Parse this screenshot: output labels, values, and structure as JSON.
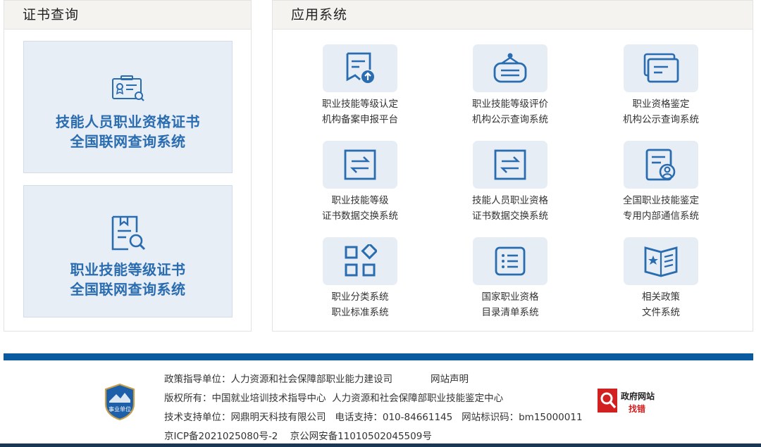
{
  "cert_panel": {
    "title": "证书查询",
    "cards": [
      {
        "line1": "技能人员职业资格证书",
        "line2": "全国联网查询系统"
      },
      {
        "line1": "职业技能等级证书",
        "line2": "全国联网查询系统"
      }
    ]
  },
  "apps_panel": {
    "title": "应用系统",
    "apps": [
      {
        "line1": "职业技能等级认定",
        "line2": "机构备案申报平台",
        "icon": "document-upload-icon"
      },
      {
        "line1": "职业技能等级评价",
        "line2": "机构公示查询系统",
        "icon": "notice-board-icon"
      },
      {
        "line1": "职业资格鉴定",
        "line2": "机构公示查询系统",
        "icon": "stacked-documents-icon"
      },
      {
        "line1": "职业技能等级",
        "line2": "证书数据交换系统",
        "icon": "exchange-arrows-icon"
      },
      {
        "line1": "技能人员职业资格",
        "line2": "证书数据交换系统",
        "icon": "exchange-arrows-icon"
      },
      {
        "line1": "全国职业技能鉴定",
        "line2": "专用内部通信系统",
        "icon": "user-document-icon"
      },
      {
        "line1": "职业分类系统",
        "line2": "职业标准系统",
        "icon": "category-grid-icon"
      },
      {
        "line1": "国家职业资格",
        "line2": "目录清单系统",
        "icon": "list-icon"
      },
      {
        "line1": "相关政策",
        "line2": "文件系统",
        "icon": "policy-book-icon"
      }
    ]
  },
  "footer": {
    "policy_label": "政策指导单位：",
    "policy_unit": "人力资源和社会保障部职业能力建设司",
    "site_statement": "网站声明",
    "copyright_label": "版权所有：",
    "copyright_unit1": "中国就业培训技术指导中心",
    "copyright_unit2": "人力资源和社会保障部职业技能鉴定中心",
    "tech_label": "技术支持单位：",
    "tech_unit": "网鼎明天科技有限公司",
    "phone_label": "电话支持：",
    "phone": "010-84661145",
    "site_id_label": "网站标识码：",
    "site_id": "bm15000011",
    "icp": "京ICP备2021025080号-2",
    "police": "京公网安备11010502045509号",
    "badge_text": "事业单位",
    "gov_error_line1": "政府网站",
    "gov_error_line2": "找错"
  },
  "colors": {
    "accent": "#2a6cb0",
    "footer_bar": "#0a5aa0",
    "tile_bg": "#e6edf5"
  }
}
